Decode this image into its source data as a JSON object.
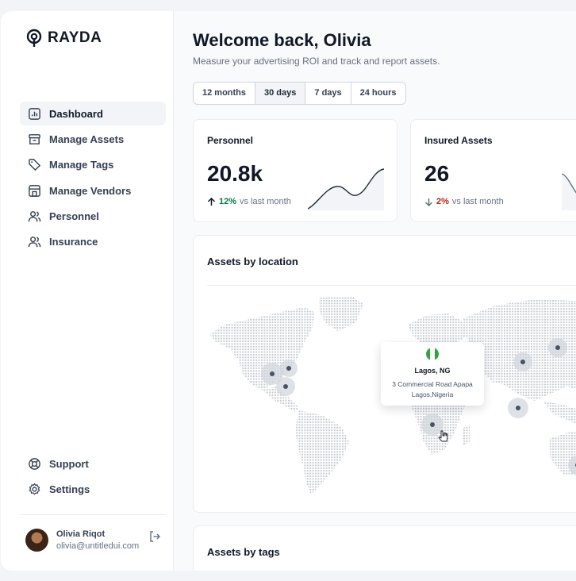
{
  "brand": {
    "name": "RAYDA"
  },
  "sidebar": {
    "items": [
      {
        "label": "Dashboard",
        "icon": "bar-chart-icon",
        "active": true
      },
      {
        "label": "Manage Assets",
        "icon": "archive-icon"
      },
      {
        "label": "Manage Tags",
        "icon": "tag-icon"
      },
      {
        "label": "Manage Vendors",
        "icon": "building-icon"
      },
      {
        "label": "Personnel",
        "icon": "users-icon"
      },
      {
        "label": "Insurance",
        "icon": "users-icon"
      }
    ],
    "bottom_items": [
      {
        "label": "Support",
        "icon": "life-buoy-icon"
      },
      {
        "label": "Settings",
        "icon": "gear-icon"
      }
    ],
    "user": {
      "name": "Olivia Riqot",
      "email": "olivia@untitledui.com"
    }
  },
  "header": {
    "title": "Welcome back, Olivia",
    "subtitle": "Measure your advertising ROI and track and report assets."
  },
  "range_tabs": [
    {
      "label": "12 months"
    },
    {
      "label": "30 days",
      "active": true
    },
    {
      "label": "7 days"
    },
    {
      "label": "24 hours"
    }
  ],
  "stats": [
    {
      "title": "Personnel",
      "value": "20.8k",
      "change": "12%",
      "direction": "up",
      "comparison": "vs last month"
    },
    {
      "title": "Insured Assets",
      "value": "26",
      "change": "2%",
      "direction": "down",
      "comparison": "vs last month"
    }
  ],
  "map": {
    "title": "Assets by location",
    "tooltip": {
      "city": "Lagos, NG",
      "address_line1": "3 Commercial Road Apapa",
      "address_line2": "Lagos,Nigeria"
    }
  },
  "tags": {
    "title": "Assets by tags"
  },
  "colors": {
    "accent": "#1d2939",
    "up": "#027a48",
    "down": "#b42318",
    "flag_green": "#32a341"
  }
}
